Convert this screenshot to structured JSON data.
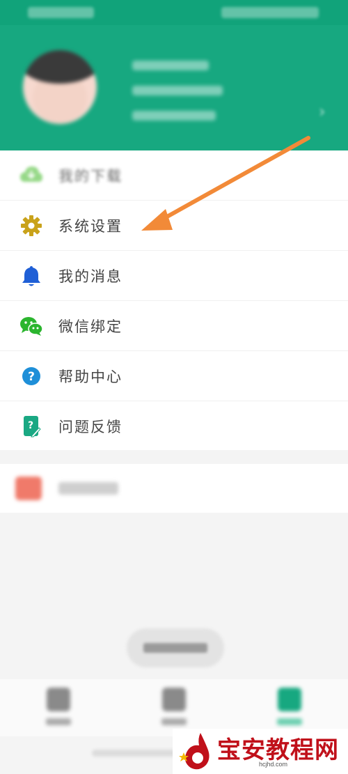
{
  "colors": {
    "brand_green": "#17a880",
    "arrow_orange": "#f28a38",
    "watermark_red": "#c0101a"
  },
  "menu": {
    "items": [
      {
        "label": "我的下载",
        "icon": "cloud-download-icon"
      },
      {
        "label": "系统设置",
        "icon": "gear-icon"
      },
      {
        "label": "我的消息",
        "icon": "bell-icon"
      },
      {
        "label": "微信绑定",
        "icon": "wechat-icon"
      },
      {
        "label": "帮助中心",
        "icon": "help-circle-icon"
      },
      {
        "label": "问题反馈",
        "icon": "feedback-edit-icon"
      }
    ]
  },
  "watermark": {
    "title": "宝安教程网",
    "subtitle": "hcjhd.com"
  }
}
